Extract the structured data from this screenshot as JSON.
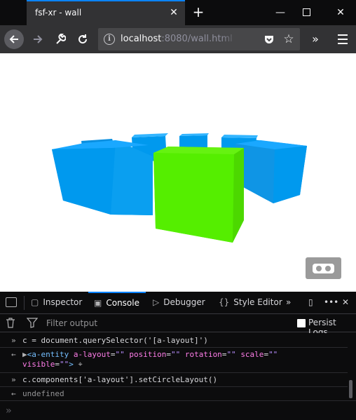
{
  "browser": {
    "tab_title": "fsf-xr - wall",
    "url_host": "localhost",
    "url_path": ":8080/wall.html"
  },
  "icons": {
    "tab_close": "close-icon",
    "new_tab": "plus-icon",
    "minimize": "minimize-icon",
    "maximize": "maximize-icon",
    "close_window": "close-icon",
    "back": "back-arrow-icon",
    "forward": "forward-arrow-icon",
    "tools": "wrench-icon",
    "reload": "reload-icon",
    "info": "info-icon",
    "pocket": "pocket-icon",
    "bookmark": "star-icon",
    "overflow": "chevrons-icon",
    "menu": "hamburger-icon",
    "vr": "vr-headset-icon"
  },
  "scene": {
    "cube_colors": {
      "front": "#55ee00",
      "others": "#0099ee"
    }
  },
  "devtools": {
    "tabs": [
      {
        "label": "Inspector"
      },
      {
        "label": "Console"
      },
      {
        "label": "Debugger"
      },
      {
        "label": "Style Editor"
      }
    ],
    "active_tab": "Console",
    "filter_placeholder": "Filter output",
    "persist_logs_label": "Persist Logs",
    "persist_logs_checked": false,
    "console": [
      {
        "kind": "input",
        "text": "c = document.querySelector('[a-layout]')"
      },
      {
        "kind": "output-element",
        "open": "<a-entity",
        "attrs": [
          {
            "name": "a-layout",
            "value": "\"\""
          },
          {
            "name": "position",
            "value": "\"\""
          },
          {
            "name": "rotation",
            "value": "\"\""
          },
          {
            "name": "scale",
            "value": "\"\""
          },
          {
            "name": "visible",
            "value": "\"\""
          }
        ],
        "close": ">"
      },
      {
        "kind": "input",
        "text": "c.components['a-layout'].setCircleLayout()"
      },
      {
        "kind": "output",
        "text": "undefined"
      }
    ],
    "prompt": "»"
  }
}
